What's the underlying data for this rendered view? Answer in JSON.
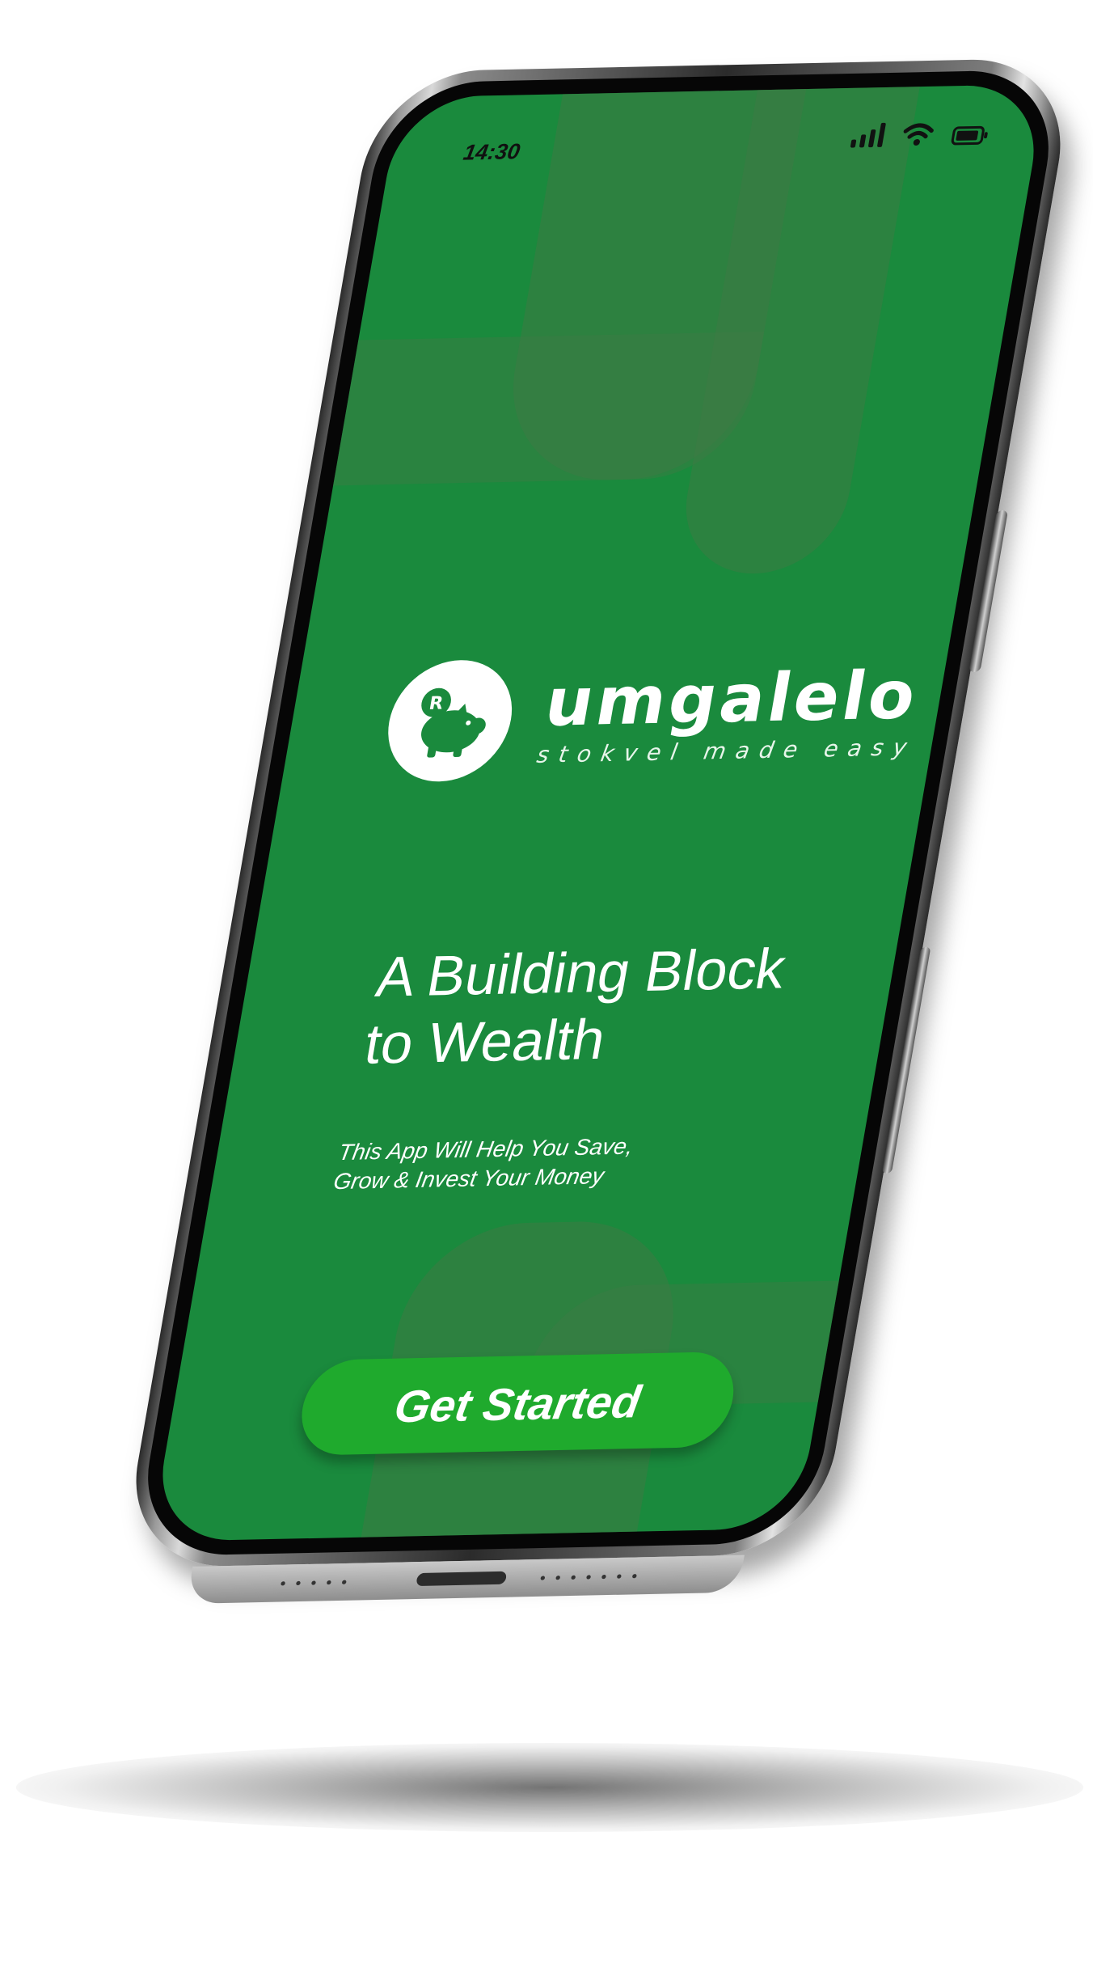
{
  "status_bar": {
    "time": "14:30",
    "signal_icon": "cellular-signal-icon",
    "wifi_icon": "wifi-icon",
    "battery_icon": "battery-icon"
  },
  "brand": {
    "name": "umgalelo",
    "tagline": "stokvel made easy",
    "logo_icon": "piggy-bank-icon",
    "logo_coin_letter": "R"
  },
  "hero": {
    "headline_line1": "A Building Block",
    "headline_line2": "to Wealth",
    "subtitle_line1": "This App Will Help You Save,",
    "subtitle_line2": "Grow & Invest Your Money"
  },
  "cta": {
    "label": "Get Started"
  },
  "colors": {
    "screen_background": "#1a8a3d",
    "shape_overlay": "#3e7a44",
    "button": "#1faa2d",
    "text": "#ffffff"
  }
}
